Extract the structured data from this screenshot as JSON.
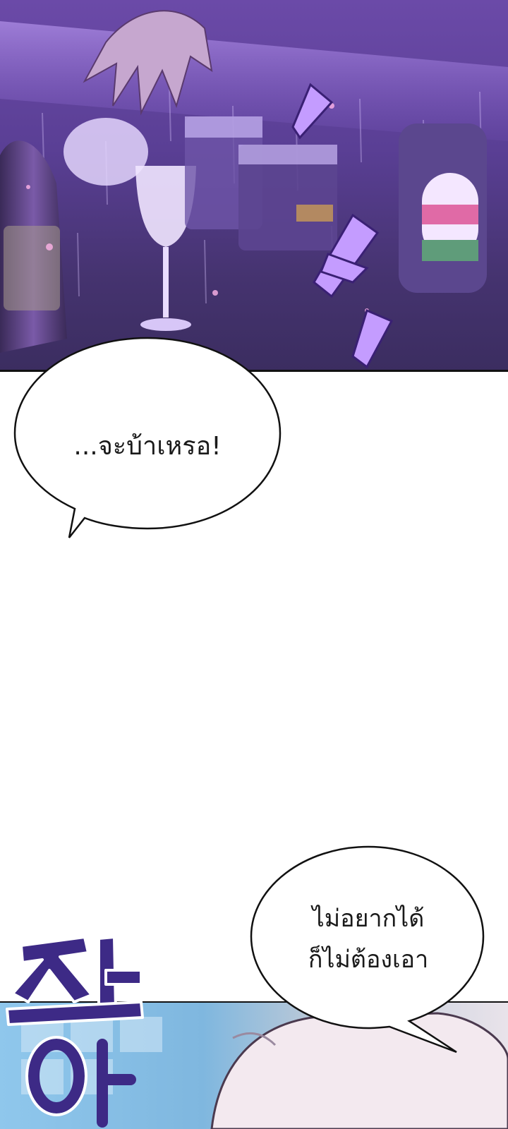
{
  "speech_bubbles": [
    {
      "text": "...จะบ้าเหรอ!"
    },
    {
      "lines": [
        "ไม่อยากได้",
        "ก็ไม่ต้องเอา"
      ]
    }
  ],
  "colors": {
    "top_panel_purple": "#5a3f95",
    "sfx_purple": "#3d2a86",
    "bottom_panel_blue": "#8fc7ec",
    "border": "#111111"
  }
}
